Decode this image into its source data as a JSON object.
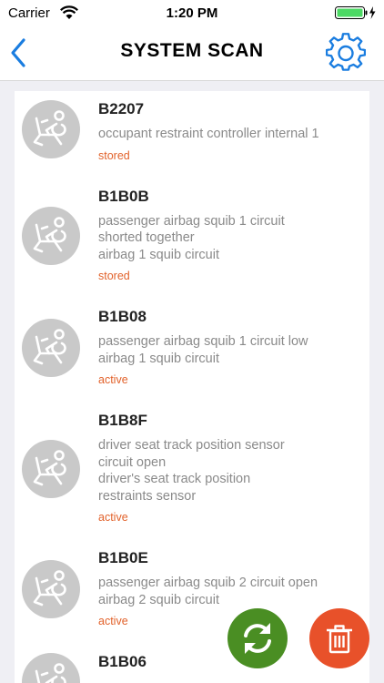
{
  "status_bar": {
    "carrier": "Carrier",
    "time": "1:20 PM",
    "wifi_icon": "wifi-icon",
    "battery_icon": "battery-charging-icon",
    "battery_color": "#4cd964"
  },
  "nav": {
    "title": "SYSTEM SCAN",
    "back_icon": "chevron-left-icon",
    "settings_icon": "gear-icon",
    "accent_color": "#1a7de0"
  },
  "codes": [
    {
      "code": "B2207",
      "description": [
        "occupant restraint controller internal 1"
      ],
      "status": "stored"
    },
    {
      "code": "B1B0B",
      "description": [
        "passenger airbag squib 1 circuit",
        "shorted together",
        "airbag 1 squib circuit"
      ],
      "status": "stored"
    },
    {
      "code": "B1B08",
      "description": [
        "passenger airbag squib 1 circuit low",
        "airbag 1 squib circuit"
      ],
      "status": "active"
    },
    {
      "code": "B1B8F",
      "description": [
        "driver seat track position sensor",
        "circuit open",
        "driver's seat track position",
        "restraints sensor"
      ],
      "status": "active"
    },
    {
      "code": "B1B0E",
      "description": [
        "passenger airbag squib 2 circuit open",
        "airbag 2 squib circuit"
      ],
      "status": "active"
    },
    {
      "code": "B1B06",
      "description": [],
      "status": ""
    }
  ],
  "item_icon": "seat-airbag-icon",
  "actions": {
    "refresh_icon": "refresh-icon",
    "delete_icon": "trash-icon",
    "refresh_color": "#4a8e23",
    "delete_color": "#e8512a"
  },
  "status_color": "#e2622b"
}
